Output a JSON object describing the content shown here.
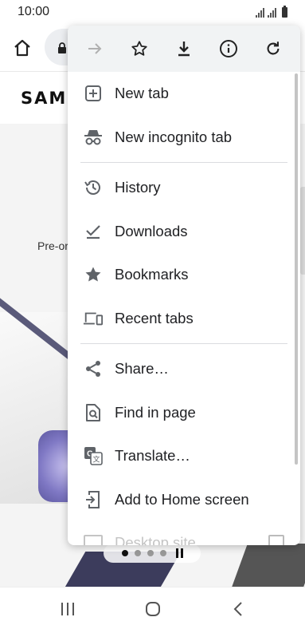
{
  "status": {
    "time": "10:00"
  },
  "page": {
    "logo_text": "SAMS",
    "preorder_text": "Pre-or"
  },
  "menu": {
    "top_icons": [
      "forward-icon",
      "bookmark-star-icon",
      "download-icon",
      "info-icon",
      "refresh-icon"
    ],
    "items_group1": [
      {
        "label": "New tab",
        "icon": "new-tab-icon"
      },
      {
        "label": "New incognito tab",
        "icon": "incognito-icon"
      }
    ],
    "items_group2": [
      {
        "label": "History",
        "icon": "history-icon"
      },
      {
        "label": "Downloads",
        "icon": "downloads-check-icon"
      },
      {
        "label": "Bookmarks",
        "icon": "star-icon"
      },
      {
        "label": "Recent tabs",
        "icon": "devices-icon"
      }
    ],
    "items_group3": [
      {
        "label": "Share…",
        "icon": "share-icon"
      },
      {
        "label": "Find in page",
        "icon": "find-in-page-icon"
      },
      {
        "label": "Translate…",
        "icon": "translate-icon"
      },
      {
        "label": "Add to Home screen",
        "icon": "add-to-home-icon"
      },
      {
        "label": "Desktop site",
        "icon": "desktop-icon"
      }
    ]
  },
  "colors": {
    "accent": "#202124",
    "menu_header_bg": "#f1f3f4",
    "earbuds": "#8a84d0"
  }
}
